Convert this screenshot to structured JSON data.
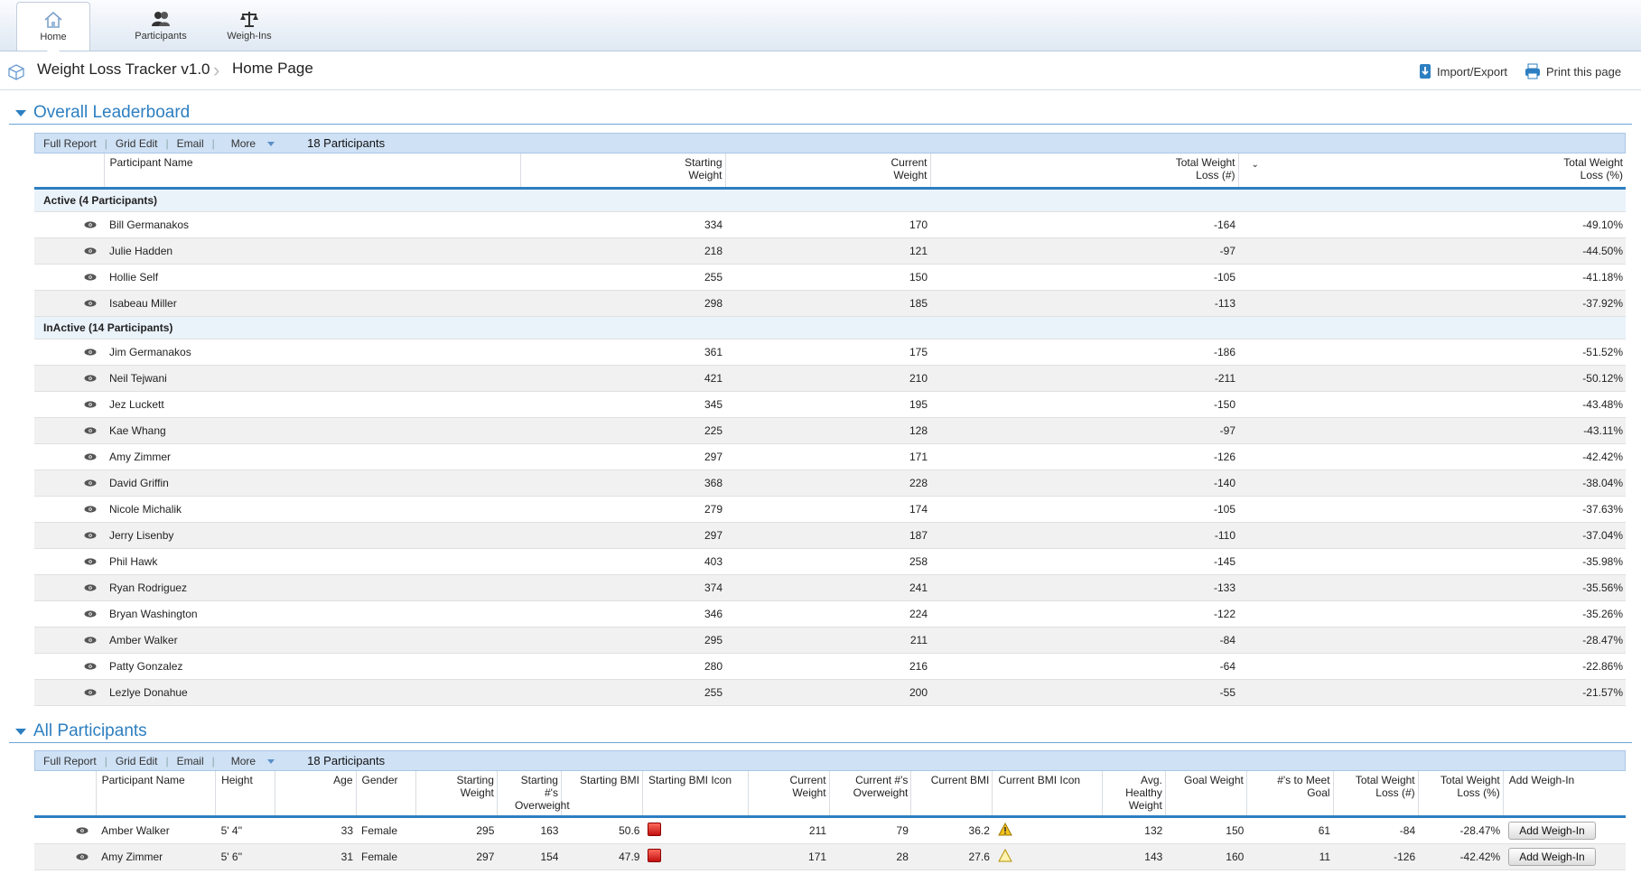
{
  "nav": {
    "items": [
      {
        "label": "Home",
        "icon": "home-icon",
        "active": true
      },
      {
        "label": "Participants",
        "icon": "participants-icon",
        "active": false
      },
      {
        "label": "Weigh-Ins",
        "icon": "scale-icon",
        "active": false
      }
    ]
  },
  "header": {
    "app_title": "Weight Loss Tracker v1.0",
    "page_title": "Home Page",
    "import_export": "Import/Export",
    "print": "Print this page"
  },
  "leaderboard": {
    "title": "Overall Leaderboard",
    "toolbar": {
      "full_report": "Full Report",
      "grid_edit": "Grid Edit",
      "email": "Email",
      "more": "More",
      "count": "18 Participants"
    },
    "columns": {
      "name": "Participant Name",
      "starting": "Starting Weight",
      "current": "Current Weight",
      "loss_num": "Total Weight Loss (#)",
      "loss_pct": "Total Weight Loss (%)"
    },
    "groups": [
      {
        "label": "Active  (4 Participants)",
        "rows": [
          [
            "Bill Germanakos",
            "334",
            "170",
            "-164",
            "-49.10%"
          ],
          [
            "Julie Hadden",
            "218",
            "121",
            "-97",
            "-44.50%"
          ],
          [
            "Hollie Self",
            "255",
            "150",
            "-105",
            "-41.18%"
          ],
          [
            "Isabeau Miller",
            "298",
            "185",
            "-113",
            "-37.92%"
          ]
        ]
      },
      {
        "label": "InActive  (14 Participants)",
        "rows": [
          [
            "Jim Germanakos",
            "361",
            "175",
            "-186",
            "-51.52%"
          ],
          [
            "Neil Tejwani",
            "421",
            "210",
            "-211",
            "-50.12%"
          ],
          [
            "Jez Luckett",
            "345",
            "195",
            "-150",
            "-43.48%"
          ],
          [
            "Kae Whang",
            "225",
            "128",
            "-97",
            "-43.11%"
          ],
          [
            "Amy Zimmer",
            "297",
            "171",
            "-126",
            "-42.42%"
          ],
          [
            "David Griffin",
            "368",
            "228",
            "-140",
            "-38.04%"
          ],
          [
            "Nicole Michalik",
            "279",
            "174",
            "-105",
            "-37.63%"
          ],
          [
            "Jerry Lisenby",
            "297",
            "187",
            "-110",
            "-37.04%"
          ],
          [
            "Phil Hawk",
            "403",
            "258",
            "-145",
            "-35.98%"
          ],
          [
            "Ryan Rodriguez",
            "374",
            "241",
            "-133",
            "-35.56%"
          ],
          [
            "Bryan Washington",
            "346",
            "224",
            "-122",
            "-35.26%"
          ],
          [
            "Amber Walker",
            "295",
            "211",
            "-84",
            "-28.47%"
          ],
          [
            "Patty Gonzalez",
            "280",
            "216",
            "-64",
            "-22.86%"
          ],
          [
            "Lezlye Donahue",
            "255",
            "200",
            "-55",
            "-21.57%"
          ]
        ]
      }
    ]
  },
  "all_participants": {
    "title": "All Participants",
    "toolbar": {
      "full_report": "Full Report",
      "grid_edit": "Grid Edit",
      "email": "Email",
      "more": "More",
      "count": "18 Participants"
    },
    "columns": [
      "Participant Name",
      "Height",
      "Age",
      "Gender",
      "Starting Weight",
      "Starting #'s Overweight",
      "Starting BMI",
      "Starting BMI Icon",
      "Current Weight",
      "Current #'s Overweight",
      "Current BMI",
      "Current BMI Icon",
      "Avg. Healthy Weight",
      "Goal Weight",
      "#'s to Meet Goal",
      "Total Weight Loss (#)",
      "Total Weight Loss (%)",
      "Add Weigh-In"
    ],
    "rows": [
      {
        "name": "Amber Walker",
        "height": "5' 4''",
        "age": "33",
        "gender": "Female",
        "start_w": "295",
        "start_over": "163",
        "start_bmi": "50.6",
        "start_icon": "red-square-icon",
        "cur_w": "211",
        "cur_over": "79",
        "cur_bmi": "36.2",
        "cur_icon": "warning-icon",
        "avg_healthy": "132",
        "goal": "150",
        "to_goal": "61",
        "loss_num": "-84",
        "loss_pct": "-28.47%",
        "button": "Add  Weigh-In"
      },
      {
        "name": "Amy Zimmer",
        "height": "5' 6''",
        "age": "31",
        "gender": "Female",
        "start_w": "297",
        "start_over": "154",
        "start_bmi": "47.9",
        "start_icon": "red-square-icon",
        "cur_w": "171",
        "cur_over": "28",
        "cur_bmi": "27.6",
        "cur_icon": "warning-outline-icon",
        "avg_healthy": "143",
        "goal": "160",
        "to_goal": "11",
        "loss_num": "-126",
        "loss_pct": "-42.42%",
        "button": "Add  Weigh-In"
      }
    ]
  }
}
